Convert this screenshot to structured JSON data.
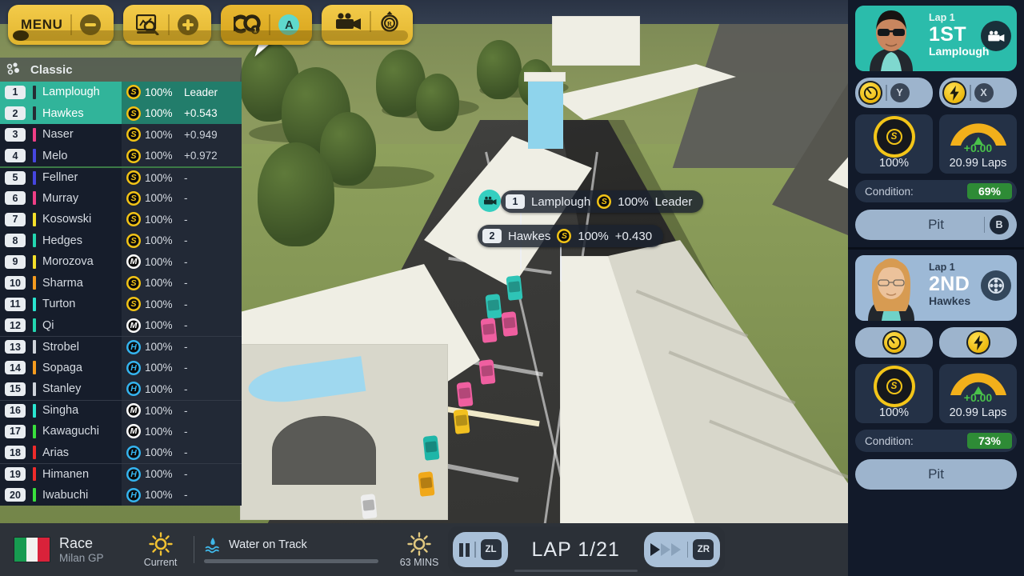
{
  "toolbar": {
    "menu_label": "MENU",
    "minus_label": "−",
    "plus_label": "+",
    "assist_label": "A",
    "groups": [
      "menu-group",
      "stats-group",
      "pit-group",
      "replay-group"
    ]
  },
  "leaderboard": {
    "title": "Classic",
    "columns": [
      "pos",
      "driver",
      "tyre",
      "wear",
      "gap"
    ],
    "rows": [
      {
        "pos": "1",
        "name": "Lamplough",
        "tyre": "S",
        "wear": "100%",
        "gap": "Leader",
        "color": "#262b33",
        "hl": true
      },
      {
        "pos": "2",
        "name": "Hawkes",
        "tyre": "S",
        "wear": "100%",
        "gap": "+0.543",
        "color": "#262b33",
        "hl": true
      },
      {
        "pos": "3",
        "name": "Naser",
        "tyre": "S",
        "wear": "100%",
        "gap": "+0.949",
        "color": "#ef3f86",
        "hl": false
      },
      {
        "pos": "4",
        "name": "Melo",
        "tyre": "S",
        "wear": "100%",
        "gap": "+0.972",
        "color": "#4646e0",
        "hl": false
      },
      {
        "pos": "5",
        "name": "Fellner",
        "tyre": "S",
        "wear": "100%",
        "gap": "-",
        "color": "#4646e0",
        "hl": false,
        "sep": "thick"
      },
      {
        "pos": "6",
        "name": "Murray",
        "tyre": "S",
        "wear": "100%",
        "gap": "-",
        "color": "#ef3f86",
        "hl": false
      },
      {
        "pos": "7",
        "name": "Kosowski",
        "tyre": "S",
        "wear": "100%",
        "gap": "-",
        "color": "#f5e02a",
        "hl": false
      },
      {
        "pos": "8",
        "name": "Hedges",
        "tyre": "S",
        "wear": "100%",
        "gap": "-",
        "color": "#23d6b0",
        "hl": false
      },
      {
        "pos": "9",
        "name": "Morozova",
        "tyre": "M",
        "wear": "100%",
        "gap": "-",
        "color": "#f5e02a",
        "hl": false
      },
      {
        "pos": "10",
        "name": "Sharma",
        "tyre": "S",
        "wear": "100%",
        "gap": "-",
        "color": "#f59c1f",
        "hl": false
      },
      {
        "pos": "11",
        "name": "Turton",
        "tyre": "S",
        "wear": "100%",
        "gap": "-",
        "color": "#2ae6d0",
        "hl": false
      },
      {
        "pos": "12",
        "name": "Qi",
        "tyre": "M",
        "wear": "100%",
        "gap": "-",
        "color": "#23d6b0",
        "hl": false
      },
      {
        "pos": "13",
        "name": "Strobel",
        "tyre": "H",
        "wear": "100%",
        "gap": "-",
        "color": "#cfd4db",
        "hl": false,
        "sep": "thin"
      },
      {
        "pos": "14",
        "name": "Sopaga",
        "tyre": "H",
        "wear": "100%",
        "gap": "-",
        "color": "#f59c1f",
        "hl": false
      },
      {
        "pos": "15",
        "name": "Stanley",
        "tyre": "H",
        "wear": "100%",
        "gap": "-",
        "color": "#cfd4db",
        "hl": false
      },
      {
        "pos": "16",
        "name": "Singha",
        "tyre": "M",
        "wear": "100%",
        "gap": "-",
        "color": "#2ae6d0",
        "hl": false,
        "sep": "thin"
      },
      {
        "pos": "17",
        "name": "Kawaguchi",
        "tyre": "M",
        "wear": "100%",
        "gap": "-",
        "color": "#39e03d",
        "hl": false
      },
      {
        "pos": "18",
        "name": "Arias",
        "tyre": "H",
        "wear": "100%",
        "gap": "-",
        "color": "#ef2b2b",
        "hl": false
      },
      {
        "pos": "19",
        "name": "Himanen",
        "tyre": "H",
        "wear": "100%",
        "gap": "-",
        "color": "#ef2b2b",
        "hl": false,
        "sep": "thin"
      },
      {
        "pos": "20",
        "name": "Iwabuchi",
        "tyre": "H",
        "wear": "100%",
        "gap": "-",
        "color": "#39e03d",
        "hl": false
      }
    ]
  },
  "world_labels": [
    {
      "pos": "1",
      "name": "Lamplough",
      "tyre": "S",
      "wear": "100%",
      "gap": "Leader"
    },
    {
      "pos": "2",
      "name": "Hawkes",
      "tyre": "S",
      "wear": "100%",
      "gap": "+0.430"
    }
  ],
  "sidebar": {
    "cards": [
      {
        "lap": "Lap 1",
        "position": "1ST",
        "name": "Lamplough",
        "badge": "camera-icon",
        "pace_key": "Y",
        "boost_key": "X",
        "tyre_compound": "S",
        "tyre_wear": "100%",
        "fuel_delta": "+0.00",
        "fuel_laps": "20.99 Laps",
        "condition_label": "Condition:",
        "condition_value": "69%",
        "pit_label": "Pit",
        "pit_key": "B"
      },
      {
        "lap": "Lap 1",
        "position": "2ND",
        "name": "Hawkes",
        "badge": "tyre-icon",
        "pace_key": "",
        "boost_key": "",
        "tyre_compound": "S",
        "tyre_wear": "100%",
        "fuel_delta": "+0.00",
        "fuel_laps": "20.99 Laps",
        "condition_label": "Condition:",
        "condition_value": "73%",
        "pit_label": "Pit",
        "pit_key": ""
      }
    ]
  },
  "bottombar": {
    "session": "Race",
    "venue": "Milan GP",
    "flag_colors": [
      "#179b50",
      "#f2f2ef",
      "#d9223a"
    ],
    "weather_current_label": "Current",
    "water_label": "Water on Track",
    "forecast_label": "63 MINS",
    "pause_key": "ZL",
    "fastforward_key": "ZR",
    "lap_counter": "LAP 1/21"
  },
  "colors": {
    "accent_teal": "#31b49a",
    "toolbar_yellow": "#f3cb4a",
    "condition_green": "#2e8b36",
    "panel_dark": "#161d2b"
  }
}
